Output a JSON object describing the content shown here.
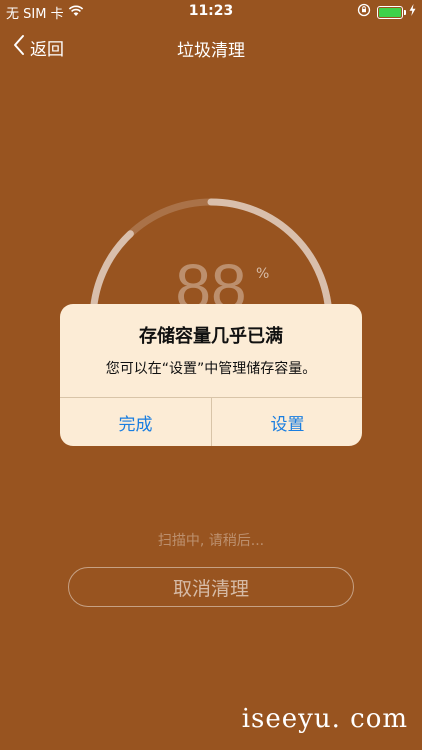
{
  "status_bar": {
    "carrier": "无 SIM 卡",
    "time": "11:23",
    "battery_level": 1.0,
    "battery_color": "#3dd24a",
    "icons": [
      "wifi-icon",
      "rotation-lock-icon",
      "battery-icon",
      "charging-bolt-icon"
    ]
  },
  "nav": {
    "back_label": "返回",
    "title": "垃圾清理"
  },
  "progress": {
    "value_text": "88",
    "percent_sign": "%",
    "fraction": 0.88
  },
  "scan_status": "扫描中, 请稍后...",
  "cancel_label": "取消清理",
  "watermark": "iseeyu. com",
  "alert": {
    "title": "存储容量几乎已满",
    "message": "您可以在“设置”中管理储存容量。",
    "done_label": "完成",
    "settings_label": "设置"
  },
  "colors": {
    "background": "#985420",
    "alert_bg": "#fcecd6",
    "alert_button": "#1a7ee0"
  }
}
